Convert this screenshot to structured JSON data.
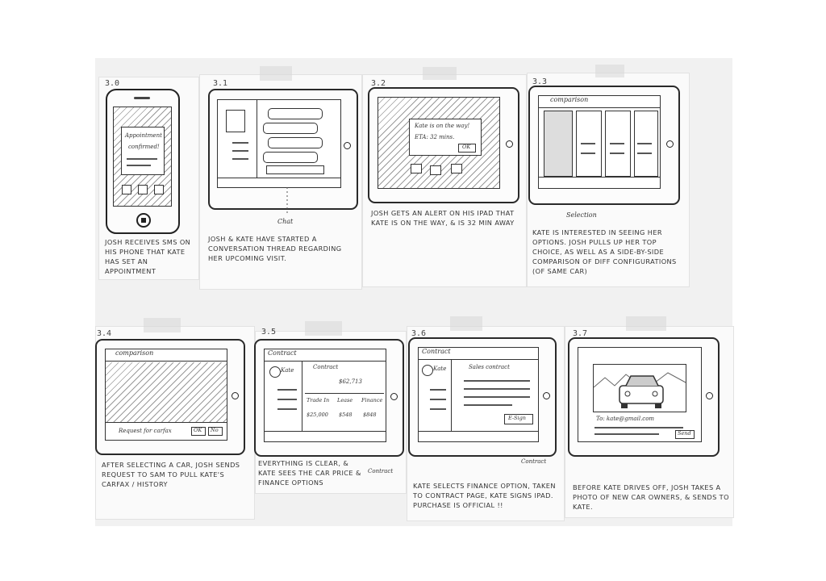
{
  "panels": [
    {
      "id": "3.0",
      "caption": "JOSH RECEIVES SMS ON HIS PHONE THAT KATE HAS SET AN APPOINTMENT",
      "phone_text": [
        "Appointment",
        "confirmed!"
      ]
    },
    {
      "id": "3.1",
      "caption": "JOSH & KATE HAVE STARTED A CONVERSATION THREAD REGARDING HER UPCOMING VISIT.",
      "annotation": "Chat"
    },
    {
      "id": "3.2",
      "caption": "JOSH GETS AN ALERT ON HIS IPAD THAT KATE IS ON THE WAY, & IS 32 MIN AWAY",
      "alert_line1": "Kate is on the way!",
      "alert_line2": "ETA: 32 mins.",
      "alert_button": "OK"
    },
    {
      "id": "3.3",
      "caption": "KATE IS INTERESTED IN SEEING HER OPTIONS. JOSH PULLS UP HER TOP CHOICE, AS WELL AS A SIDE-BY-SIDE COMPARISON OF DIFF CONFIGURATIONS (OF SAME CAR)",
      "screen_title": "comparison",
      "annotation": "Selection"
    },
    {
      "id": "3.4",
      "caption": "AFTER SELECTING A CAR, JOSH SENDS REQUEST TO SAM TO PULL KATE'S CARFAX / HISTORY",
      "screen_title": "comparison",
      "request_text": "Request for carfax",
      "ok_label": "OK",
      "no_label": "No"
    },
    {
      "id": "3.5",
      "caption": "EVERYTHING IS CLEAR, & KATE SEES THE CAR PRICE & FINANCE OPTIONS",
      "screen_title": "Contract",
      "user_name": "Kate",
      "sub_title": "Contract",
      "price": "$62,713",
      "trade_in_label": "Trade In",
      "trade_in_value": "$25,000",
      "lease_label": "Lease",
      "lease_value": "$548",
      "finance_label": "Finance",
      "finance_value": "$848",
      "annotation": "Contract"
    },
    {
      "id": "3.6",
      "caption": "KATE SELECTS FINANCE OPTION, TAKEN TO CONTRACT PAGE, KATE SIGNS IPAD. PURCHASE IS OFFICIAL !!",
      "screen_title": "Contract",
      "user_name": "Kate",
      "sub_title": "Sales contract",
      "esign_label": "E-Sign",
      "annotation": "Contract"
    },
    {
      "id": "3.7",
      "caption": "BEFORE KATE DRIVES OFF, JOSH TAKES A PHOTO OF NEW CAR OWNERS, & SENDS TO KATE.",
      "to_text": "To: kate@gmail.com",
      "send_label": "Send"
    }
  ]
}
